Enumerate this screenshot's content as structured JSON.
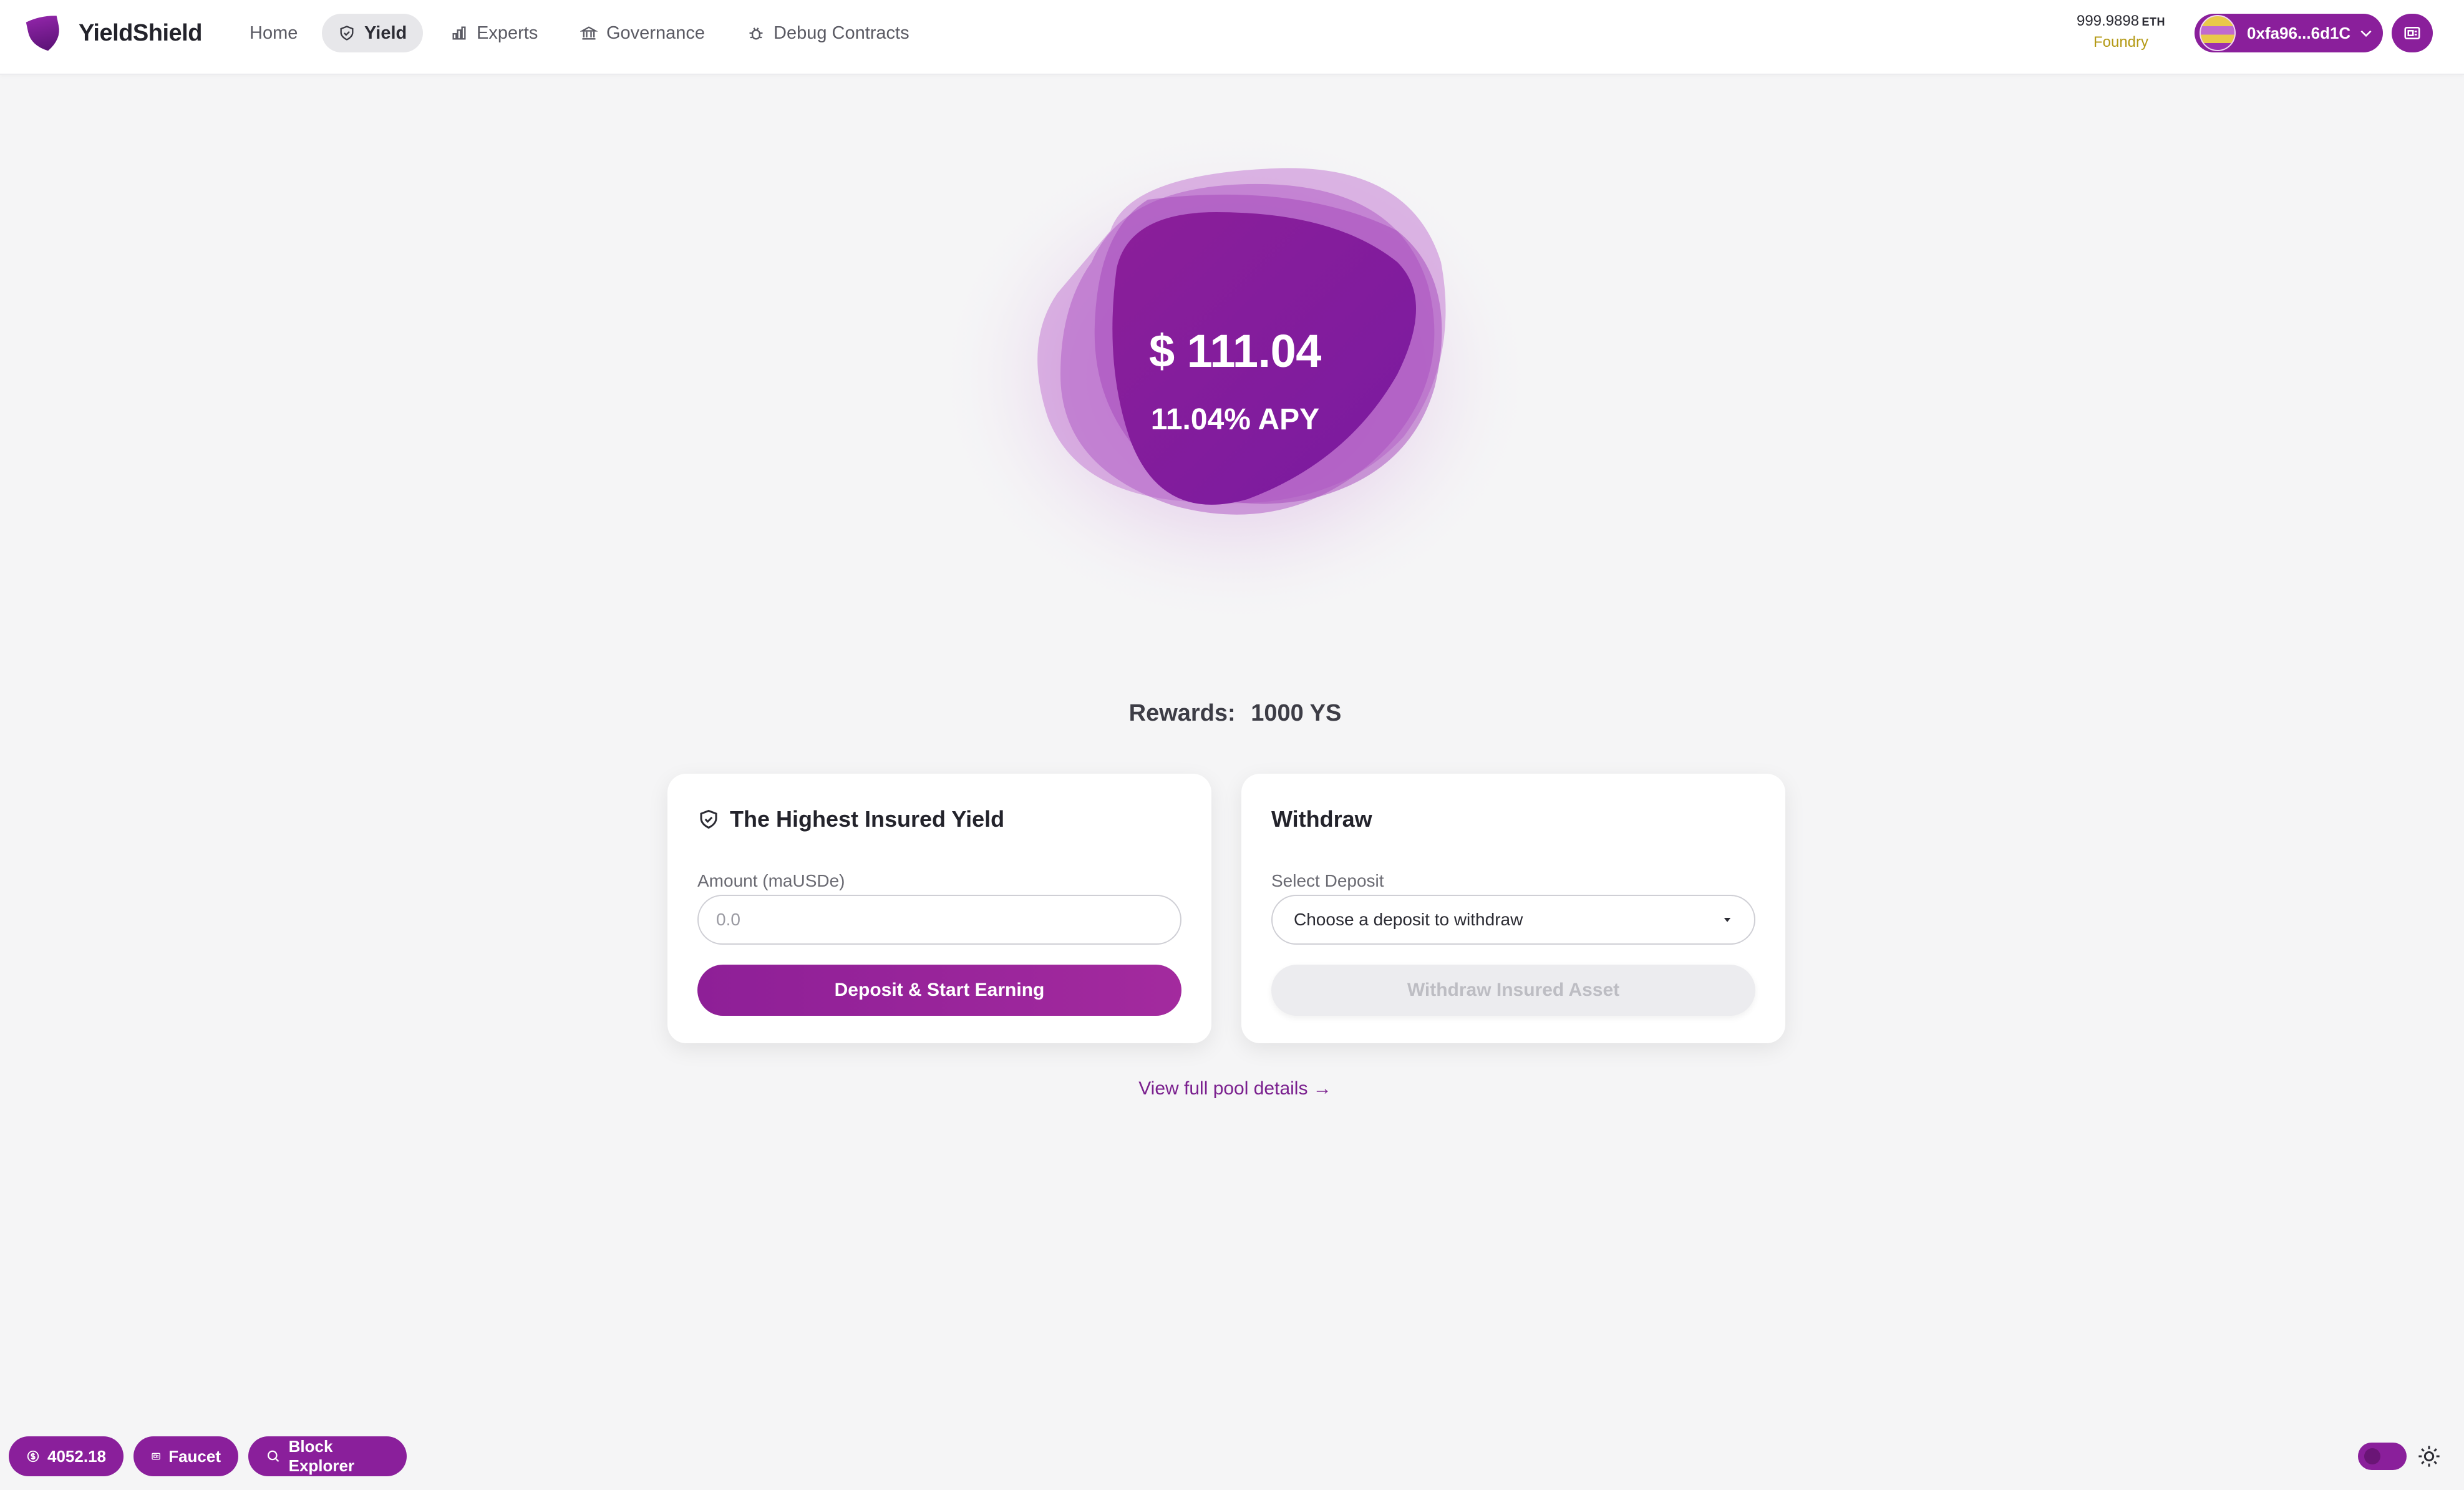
{
  "brand": {
    "name": "YieldShield"
  },
  "nav": {
    "items": [
      {
        "label": "Home",
        "icon": "",
        "active": false
      },
      {
        "label": "Yield",
        "icon": "shield-icon",
        "active": true
      },
      {
        "label": "Experts",
        "icon": "bar-chart-icon",
        "active": false
      },
      {
        "label": "Governance",
        "icon": "bank-icon",
        "active": false
      },
      {
        "label": "Debug Contracts",
        "icon": "bug-icon",
        "active": false
      }
    ]
  },
  "wallet": {
    "balance": "999.9898",
    "unit": "ETH",
    "network": "Foundry",
    "address": "0xfa96...6d1C"
  },
  "hero": {
    "value": "$ 111.04",
    "apy": "11.04% APY"
  },
  "rewards": {
    "label": "Rewards:",
    "value": "1000 YS"
  },
  "deposit_card": {
    "title": "The Highest Insured Yield",
    "amount_label": "Amount (maUSDe)",
    "amount_placeholder": "0.0",
    "button": "Deposit & Start Earning"
  },
  "withdraw_card": {
    "title": "Withdraw",
    "select_label": "Select Deposit",
    "select_value": "Choose a deposit to withdraw",
    "button": "Withdraw Insured Asset"
  },
  "pool_link": "View full pool details →",
  "footer": {
    "price": "4052.18",
    "faucet": "Faucet",
    "explorer": "Block Explorer"
  },
  "colors": {
    "accent": "#8a1f9b",
    "network": "#b49a16",
    "background": "#f5f5f6"
  }
}
